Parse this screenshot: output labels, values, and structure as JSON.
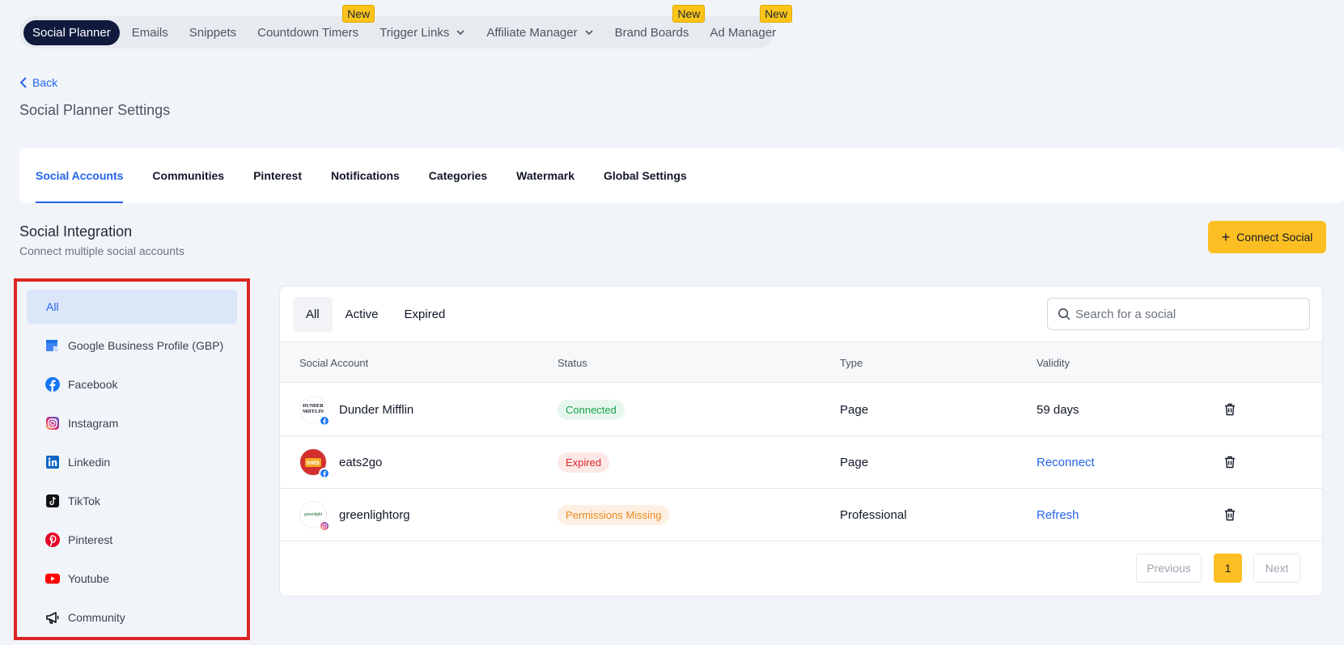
{
  "topnav": {
    "items": [
      {
        "label": "Social Planner",
        "active": true
      },
      {
        "label": "Emails"
      },
      {
        "label": "Snippets"
      },
      {
        "label": "Countdown Timers",
        "badge": "New"
      },
      {
        "label": "Trigger Links"
      },
      {
        "label": "Affiliate Manager"
      },
      {
        "label": "Brand Boards",
        "badge": "New"
      },
      {
        "label": "Ad Manager",
        "badge": "New"
      }
    ]
  },
  "back_label": "Back",
  "page_title": "Social Planner Settings",
  "tabs": [
    "Social Accounts",
    "Communities",
    "Pinterest",
    "Notifications",
    "Categories",
    "Watermark",
    "Global Settings"
  ],
  "section": {
    "title": "Social Integration",
    "subtitle": "Connect multiple social accounts",
    "connect_label": "Connect Social"
  },
  "sidebar": {
    "items": [
      {
        "label": "All",
        "icon": "none"
      },
      {
        "label": "Google Business Profile (GBP)",
        "icon": "google-business-icon"
      },
      {
        "label": "Facebook",
        "icon": "facebook-icon"
      },
      {
        "label": "Instagram",
        "icon": "instagram-icon"
      },
      {
        "label": "Linkedin",
        "icon": "linkedin-icon"
      },
      {
        "label": "TikTok",
        "icon": "tiktok-icon"
      },
      {
        "label": "Pinterest",
        "icon": "pinterest-icon"
      },
      {
        "label": "Youtube",
        "icon": "youtube-icon"
      },
      {
        "label": "Community",
        "icon": "megaphone-icon"
      }
    ]
  },
  "filters": [
    "All",
    "Active",
    "Expired"
  ],
  "search": {
    "placeholder": "Search for a social"
  },
  "table": {
    "headers": [
      "Social Account",
      "Status",
      "Type",
      "Validity"
    ],
    "rows": [
      {
        "name": "Dunder Mifflin",
        "avatar_text": "DUNDER MIFFLIN",
        "network": "facebook",
        "status": "Connected",
        "type": "Page",
        "validity": "59 days"
      },
      {
        "name": "eats2go",
        "avatar_text": "eats",
        "network": "facebook",
        "status": "Expired",
        "type": "Page",
        "validity": "Reconnect"
      },
      {
        "name": "greenlightorg",
        "avatar_text": "greenlight",
        "network": "instagram",
        "status": "Permissions Missing",
        "type": "Professional",
        "validity": "Refresh"
      }
    ]
  },
  "pagination": {
    "previous": "Previous",
    "page": "1",
    "next": "Next"
  },
  "colors": {
    "accent": "#2563eb",
    "brand_yellow": "#fbbf24",
    "nav_active": "#0f1a3d",
    "highlight_border": "#dc2626"
  }
}
